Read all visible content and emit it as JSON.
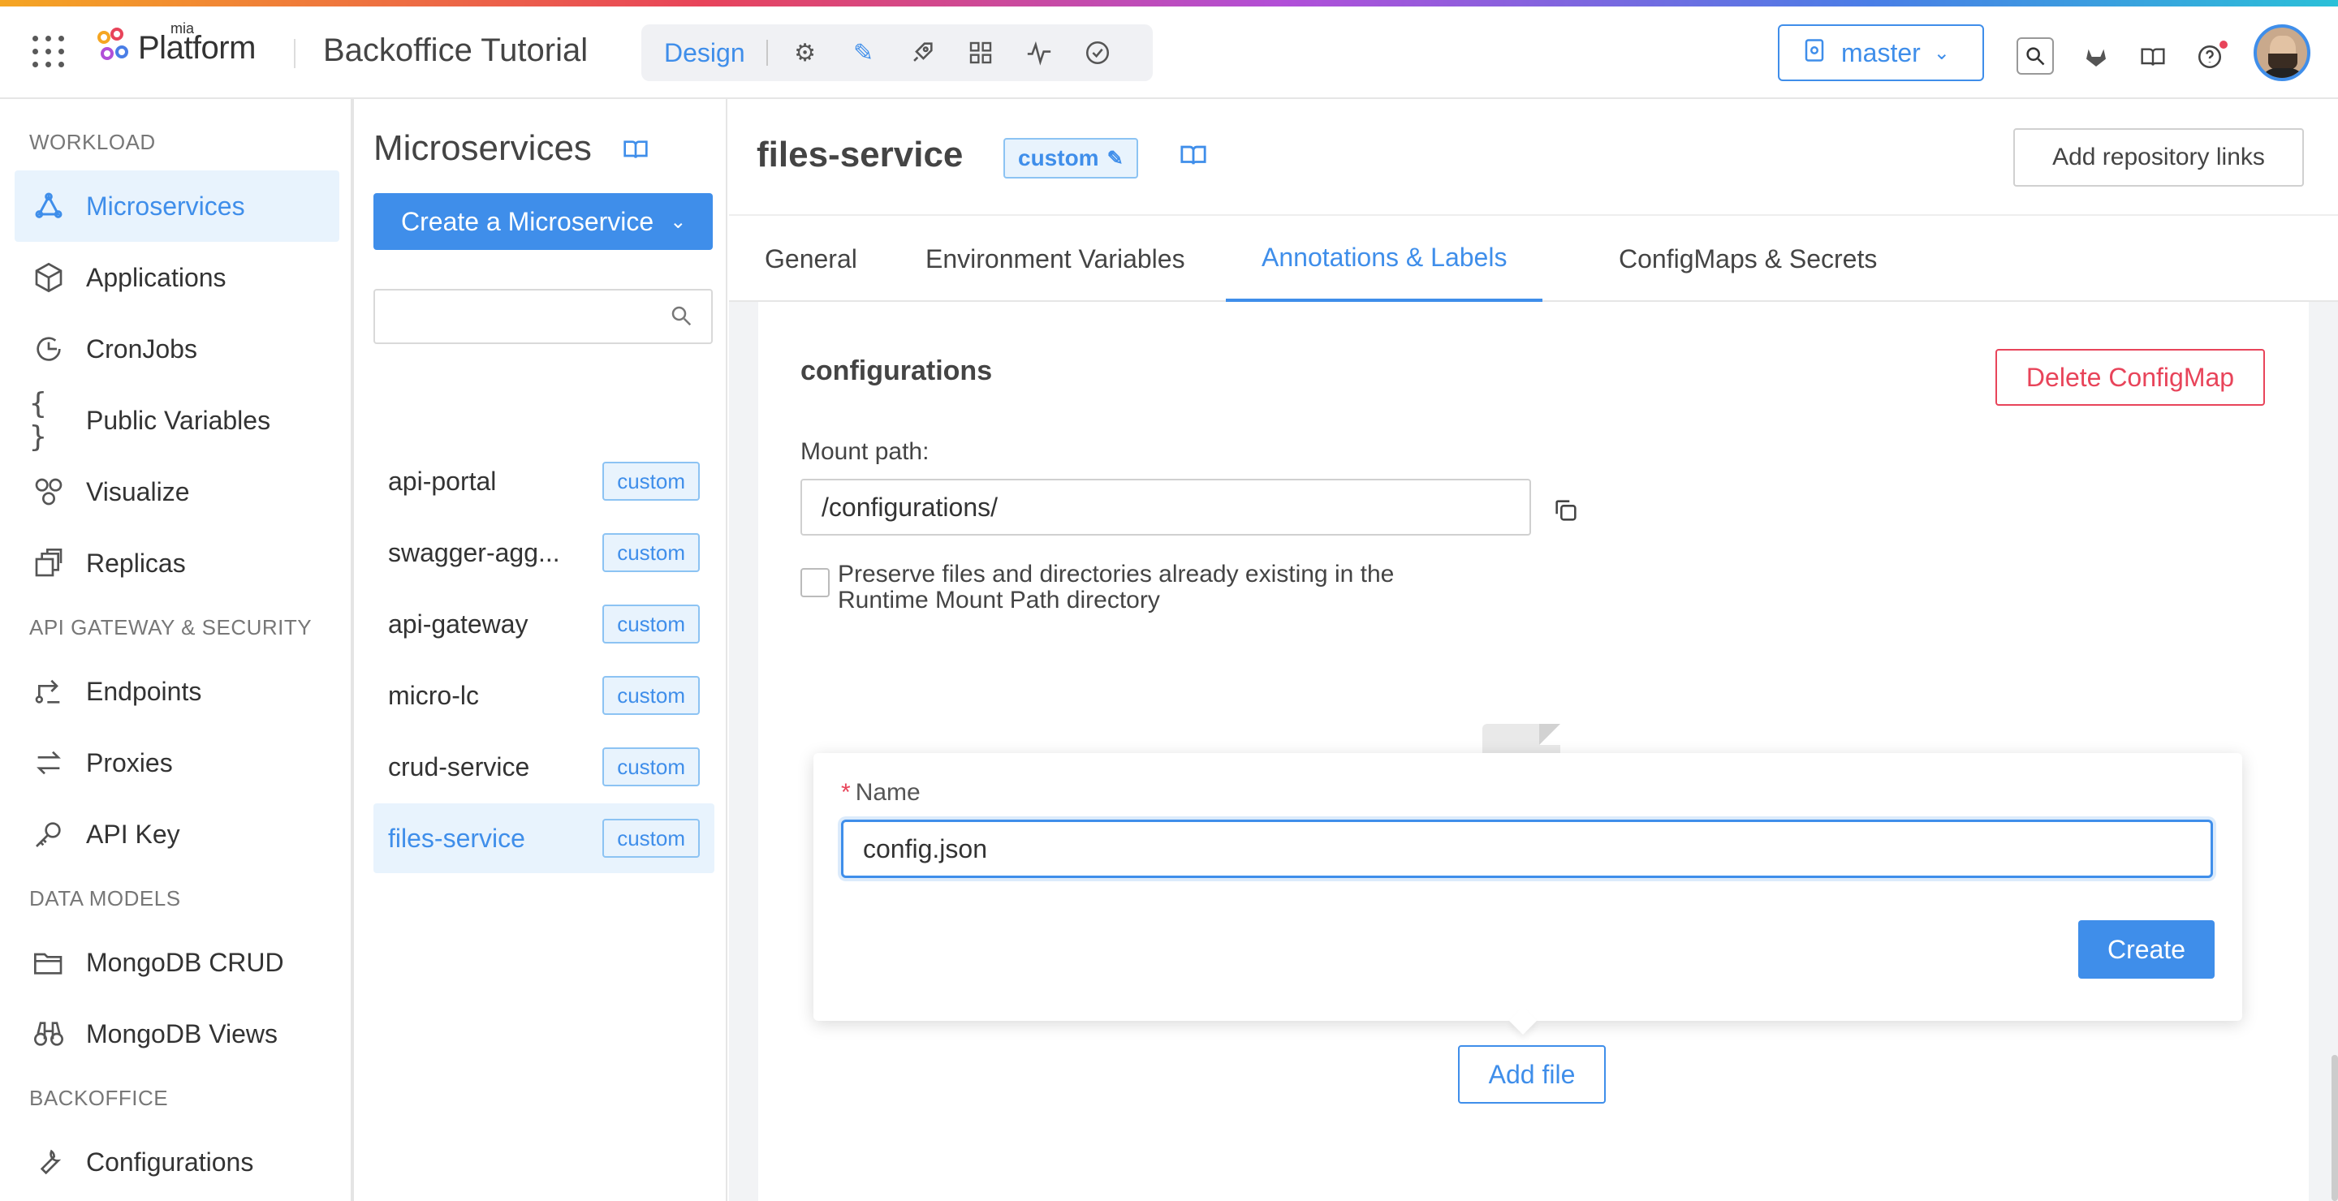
{
  "header": {
    "logo_small": "mia",
    "logo_big": "Platform",
    "project_title": "Backoffice Tutorial",
    "mode_label": "Design",
    "mode_icons": [
      "gear-icon",
      "pencil-icon",
      "rocket-icon",
      "grid-icon",
      "pulse-icon",
      "check-circle-icon"
    ],
    "branch": "master",
    "right_icons": [
      "search-icon",
      "gitlab-icon",
      "book-icon",
      "help-icon"
    ]
  },
  "sidebar": {
    "sections": [
      {
        "label": "WORKLOAD"
      },
      {
        "label": "API GATEWAY & SECURITY"
      },
      {
        "label": "DATA MODELS"
      },
      {
        "label": "BACKOFFICE"
      }
    ],
    "items": [
      {
        "label": "Microservices",
        "icon": "microservices-icon"
      },
      {
        "label": "Applications",
        "icon": "cube-icon"
      },
      {
        "label": "CronJobs",
        "icon": "clock-icon"
      },
      {
        "label": "Public Variables",
        "icon": "braces-icon"
      },
      {
        "label": "Visualize",
        "icon": "nodes-icon"
      },
      {
        "label": "Replicas",
        "icon": "replicas-icon"
      },
      {
        "label": "Endpoints",
        "icon": "endpoints-icon"
      },
      {
        "label": "Proxies",
        "icon": "swap-icon"
      },
      {
        "label": "API Key",
        "icon": "key-icon"
      },
      {
        "label": "MongoDB CRUD",
        "icon": "folder-icon"
      },
      {
        "label": "MongoDB Views",
        "icon": "binoculars-icon"
      },
      {
        "label": "Configurations",
        "icon": "wrench-icon"
      }
    ]
  },
  "middle": {
    "title": "Microservices",
    "create_label": "Create a Microservice",
    "search_placeholder": "",
    "services": [
      {
        "name": "api-portal",
        "tag": "custom"
      },
      {
        "name": "swagger-agg...",
        "tag": "custom"
      },
      {
        "name": "api-gateway",
        "tag": "custom"
      },
      {
        "name": "micro-lc",
        "tag": "custom"
      },
      {
        "name": "crud-service",
        "tag": "custom"
      },
      {
        "name": "files-service",
        "tag": "custom"
      }
    ]
  },
  "main": {
    "service_name": "files-service",
    "service_tag": "custom",
    "repo_button": "Add repository links",
    "tabs": [
      {
        "label": "General"
      },
      {
        "label": "Environment Variables"
      },
      {
        "label": "Annotations & Labels"
      },
      {
        "label": "ConfigMaps & Secrets"
      }
    ],
    "config": {
      "title": "configurations",
      "delete_label": "Delete ConfigMap",
      "mount_label": "Mount path:",
      "mount_value": "/configurations/",
      "preserve_label": "Preserve files and directories already existing in the Runtime Mount Path directory",
      "name_required": "*",
      "name_label": "Name",
      "name_value": "config.json",
      "create_label": "Create",
      "add_file_label": "Add file"
    }
  },
  "colors": {
    "accent": "#3f8eea",
    "danger": "#e8445a"
  }
}
